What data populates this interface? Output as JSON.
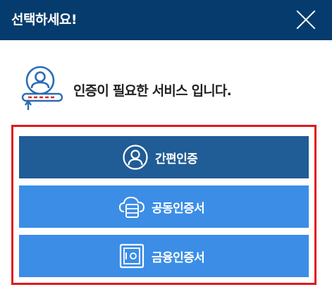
{
  "dialog": {
    "title": "선택하세요!",
    "close_icon": "close-icon"
  },
  "notice": {
    "icon": "user-authentication-icon",
    "text": "인증이 필요한 서비스 입니다."
  },
  "options": [
    {
      "label": "간편인증",
      "icon": "user-circle-icon"
    },
    {
      "label": "공동인증서",
      "icon": "cloud-server-icon"
    },
    {
      "label": "금융인증서",
      "icon": "safe-icon"
    }
  ],
  "colors": {
    "header": "#053c6d",
    "option_primary": "#205c96",
    "option_secondary": "#3b8de6",
    "highlight_border": "#e0191b",
    "icon_blue": "#2a6cb6"
  }
}
